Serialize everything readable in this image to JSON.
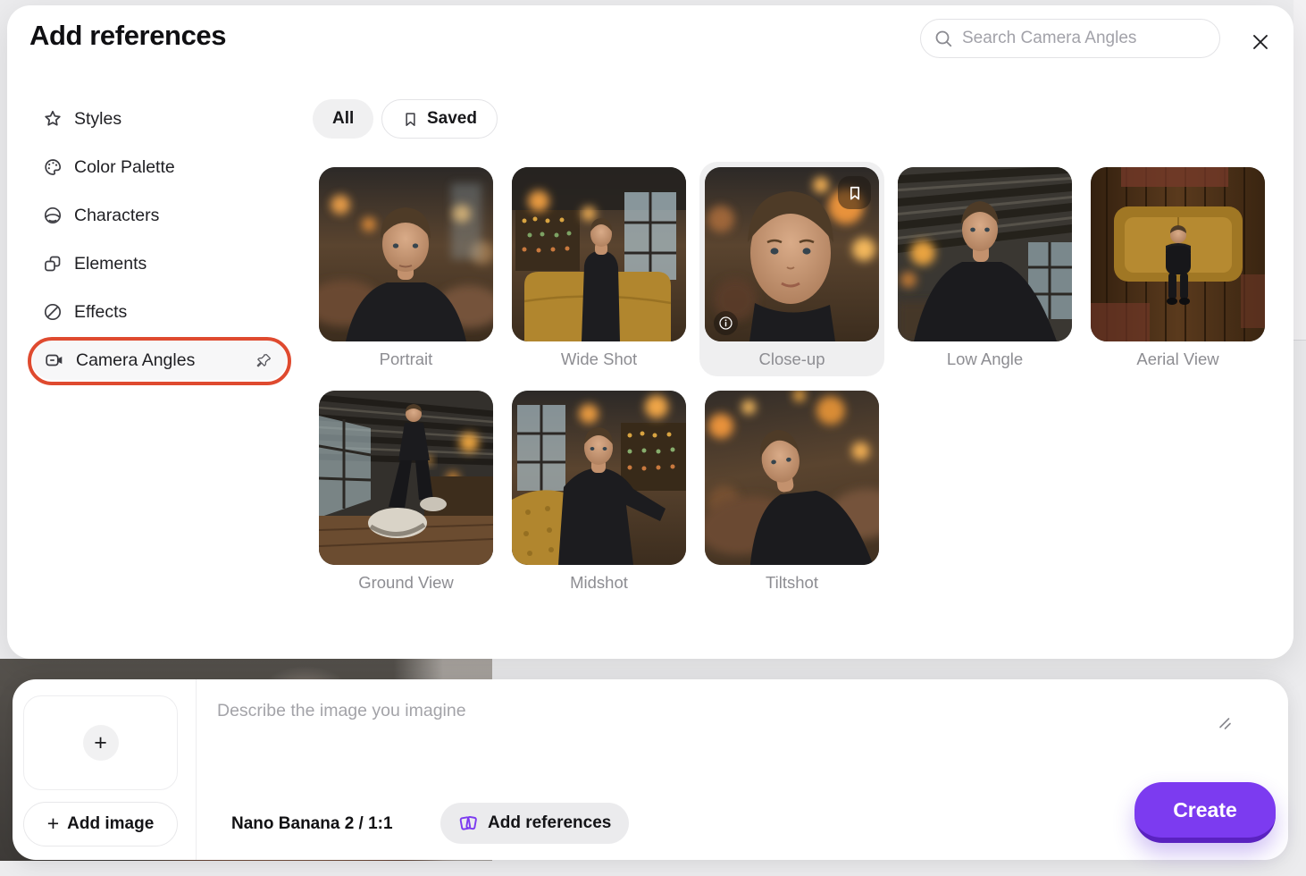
{
  "modal": {
    "title": "Add references",
    "search": {
      "placeholder": "Search Camera Angles"
    }
  },
  "sidebar": {
    "items": [
      {
        "label": "Styles",
        "icon": "star"
      },
      {
        "label": "Color Palette",
        "icon": "palette"
      },
      {
        "label": "Characters",
        "icon": "character-face"
      },
      {
        "label": "Elements",
        "icon": "overlapping-shapes"
      },
      {
        "label": "Effects",
        "icon": "slashed-circle"
      },
      {
        "label": "Camera Angles",
        "icon": "video-camera",
        "active": true,
        "pinned": true
      }
    ],
    "active_item": "Camera Angles",
    "highlight_ring_color": "#df4a2f"
  },
  "filters": {
    "all_label": "All",
    "saved_label": "Saved",
    "active": "All"
  },
  "cards": [
    {
      "label": "Portrait",
      "scene": "portrait"
    },
    {
      "label": "Wide Shot",
      "scene": "wide"
    },
    {
      "label": "Close-up",
      "scene": "closeup",
      "selected": true,
      "bookmarked": true,
      "has_info_badge": true
    },
    {
      "label": "Low Angle",
      "scene": "lowangle"
    },
    {
      "label": "Aerial View",
      "scene": "aerial"
    },
    {
      "label": "Ground View",
      "scene": "ground"
    },
    {
      "label": "Midshot",
      "scene": "midshot"
    },
    {
      "label": "Tiltshot",
      "scene": "tiltshot"
    }
  ],
  "composer": {
    "prompt_placeholder": "Describe the image you imagine",
    "add_image_plus": "+",
    "add_image_label": "Add image",
    "model_label": "Nano Banana 2 / 1:1",
    "add_references_label": "Add references",
    "create_label": "Create"
  },
  "icons": {
    "search": "magnifier",
    "close": "x-mark",
    "saved_tab": "bookmark",
    "selected_card_top_right": "bookmark",
    "selected_card_bottom_left": "info-circle",
    "pin": "pushpin",
    "add_references_button": "stacked-cards",
    "textarea_corner": "resize-diagonal-lines"
  },
  "colors": {
    "accent_purple": "#7c3bf0",
    "accent_purple_dark": "#5a22c0",
    "highlight_red": "#df4a2f",
    "selected_card_bg": "#efeff0",
    "page_bg": "#ececee",
    "label_gray": "#8d8d92"
  }
}
